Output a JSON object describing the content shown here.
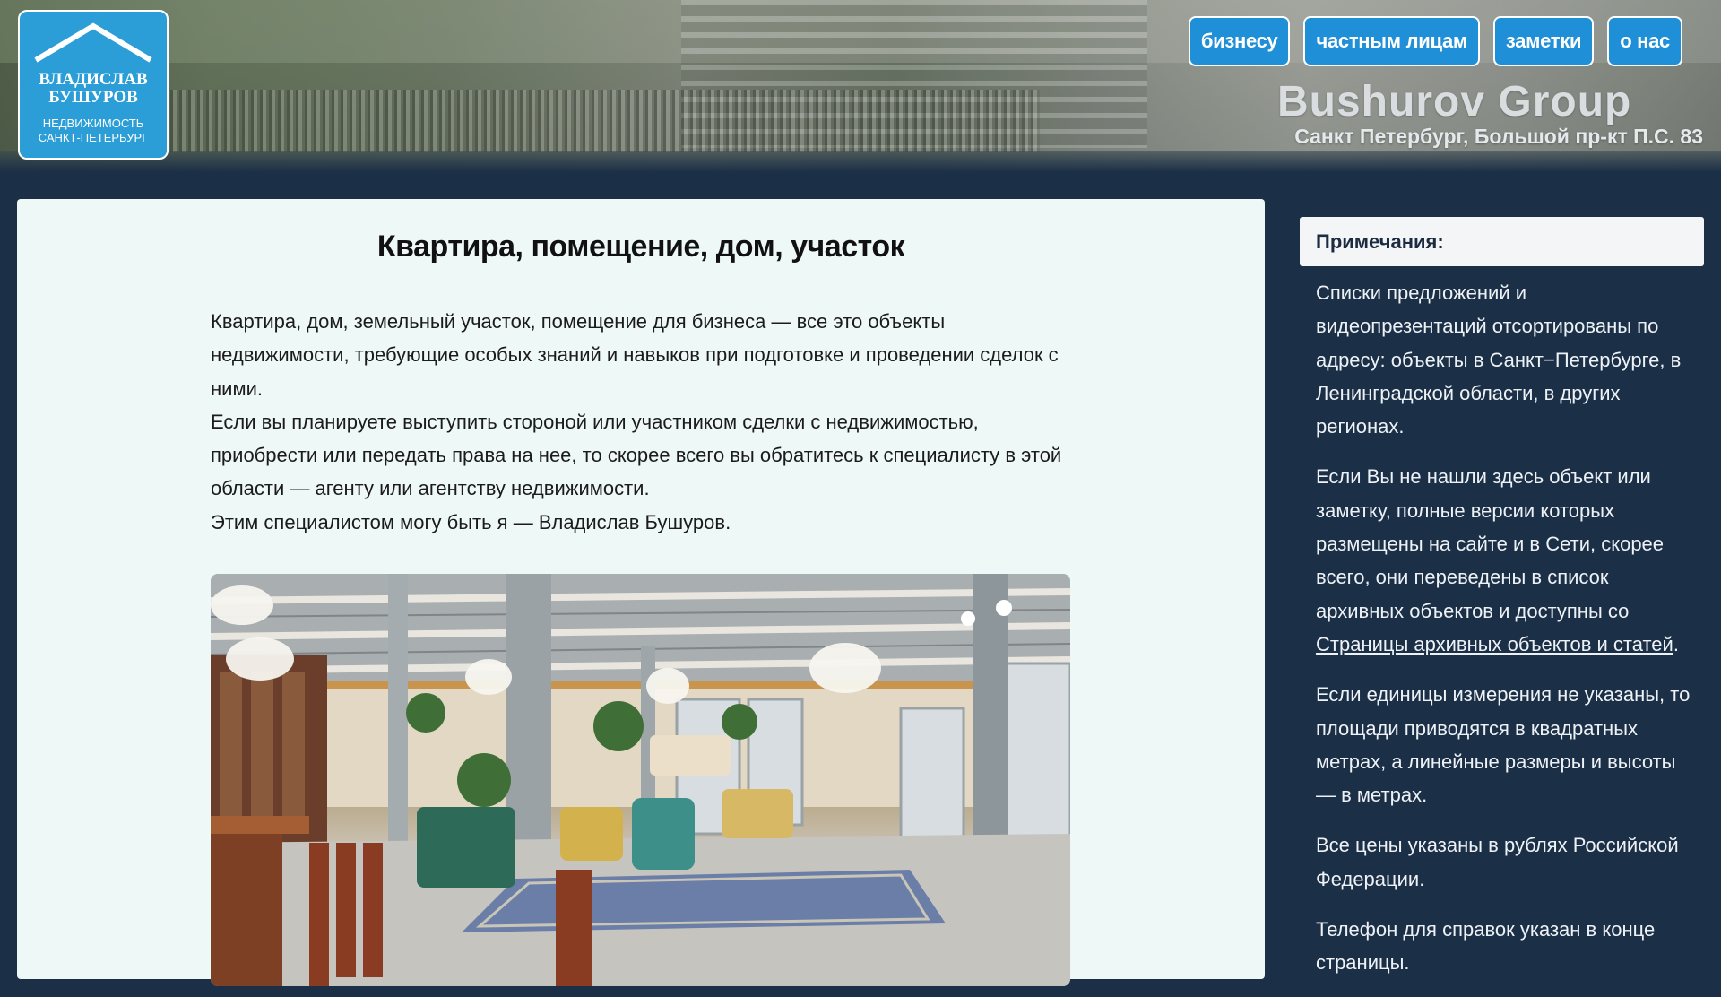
{
  "header": {
    "logo": {
      "line1a": "ВЛАДИСЛАВ",
      "line1b": "БУШУРОВ",
      "line2a": "НЕДВИЖИМОСТЬ",
      "line2b": "САНКТ-ПЕТЕРБУРГ"
    },
    "nav": [
      {
        "label": "бизнесу"
      },
      {
        "label": "частным лицам"
      },
      {
        "label": "заметки"
      },
      {
        "label": "о нас"
      }
    ],
    "brand": "Bushurov Group",
    "address": "Санкт Петербург, Большой пр-кт П.С. 83"
  },
  "main": {
    "title": "Квартира, помещение, дом, участок",
    "paragraphs": [
      "Квартира, дом, земельный участок, помещение для бизнеса — все это объекты недвижимости, требующие особых знаний и навыков при подготовке и проведении сделок с ними.",
      "Если вы планируете выступить стороной или участником сделки с недвижимостью, приобрести или передать права на нее, то скорее всего вы обратитесь к специалисту в этой области — агенту или агентству недвижимости.",
      "Этим специалистом могу быть я — Владислав Бушуров."
    ]
  },
  "sidebar": {
    "heading": "Примечания:",
    "note1": "Списки предложений и видеопрезентаций отсортированы по адресу: объекты в Санкт−Петербурге, в Ленинградской области, в других регионах.",
    "note2_prefix": "Если Вы не нашли здесь объект или заметку, полные версии которых размещены на сайте и в Сети, скорее всего, они переведены в список архивных объектов и доступны со ",
    "note2_link": "Страницы архивных объектов и статей",
    "note2_suffix": ".",
    "note3": "Если единицы измерения не указаны, то площади приводятся в квадратных метрах, а линейные размеры и высоты — в метрах.",
    "note4": "Все цены указаны в рублях Российской Федерации.",
    "note5": "Телефон для справок указан в конце страницы."
  },
  "colors": {
    "page_bg": "#1b2f47",
    "nav_button": "#1f8fd8",
    "logo_bg": "#2b9ed8",
    "main_bg": "#eef8f6"
  }
}
